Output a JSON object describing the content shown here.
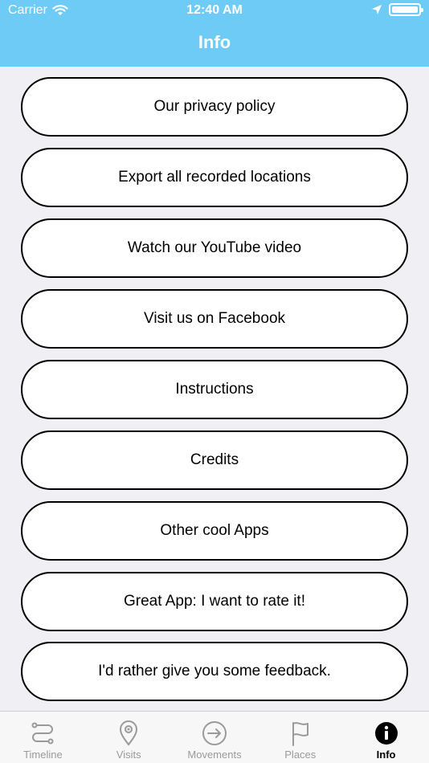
{
  "status_bar": {
    "carrier": "Carrier",
    "time": "12:40 AM"
  },
  "nav": {
    "title": "Info"
  },
  "menu": [
    {
      "label": "Our privacy policy"
    },
    {
      "label": "Export all recorded locations"
    },
    {
      "label": "Watch our YouTube video"
    },
    {
      "label": "Visit us on Facebook"
    },
    {
      "label": "Instructions"
    },
    {
      "label": "Credits"
    },
    {
      "label": "Other cool Apps"
    },
    {
      "label": "Great App: I want to rate it!"
    },
    {
      "label": "I'd rather give you some feedback."
    }
  ],
  "tabs": [
    {
      "label": "Timeline",
      "icon": "timeline-icon"
    },
    {
      "label": "Visits",
      "icon": "map-pin-icon"
    },
    {
      "label": "Movements",
      "icon": "arrow-circle-icon"
    },
    {
      "label": "Places",
      "icon": "flag-icon"
    },
    {
      "label": "Info",
      "icon": "info-icon",
      "active": true
    }
  ],
  "colors": {
    "header": "#6dcbf6",
    "background": "#efeff4",
    "tab_inactive": "#9a9a9a",
    "tab_active": "#000000"
  }
}
